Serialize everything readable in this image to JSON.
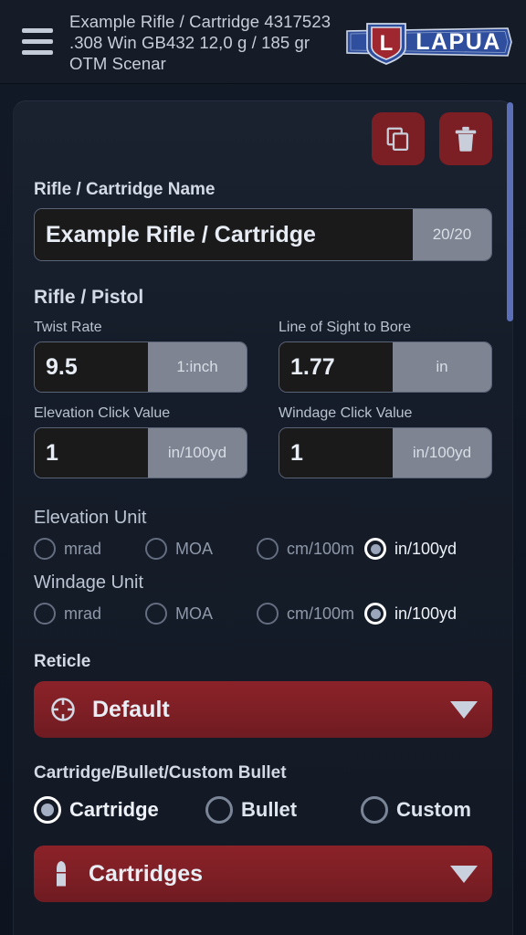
{
  "header": {
    "menu_icon": "hamburger-icon",
    "title": "Example Rifle / Cartridge 4317523 .308 Win GB432 12,0 g / 185 gr  OTM Scenar",
    "logo_text": "LAPUA",
    "logo_shield_letter": "L"
  },
  "toolbar": {
    "duplicate_icon": "copy-icon",
    "delete_icon": "trash-icon",
    "button_color": "#7c1f24"
  },
  "name_section": {
    "label": "Rifle / Cartridge Name",
    "value": "Example Rifle / Cartridge",
    "counter": "20/20"
  },
  "rifle_section": {
    "heading": "Rifle / Pistol",
    "fields": [
      {
        "label": "Twist Rate",
        "value": "9.5",
        "unit": "1:inch"
      },
      {
        "label": "Line of Sight to Bore",
        "value": "1.77",
        "unit": "in"
      },
      {
        "label": "Elevation Click Value",
        "value": "1",
        "unit": "in/100yd"
      },
      {
        "label": "Windage Click Value",
        "value": "1",
        "unit": "in/100yd"
      }
    ]
  },
  "elevation_unit": {
    "heading": "Elevation Unit",
    "options": [
      {
        "label": "mrad",
        "selected": false
      },
      {
        "label": "MOA",
        "selected": false
      },
      {
        "label": "cm/100m",
        "selected": false
      },
      {
        "label": "in/100yd",
        "selected": true
      }
    ]
  },
  "windage_unit": {
    "heading": "Windage Unit",
    "options": [
      {
        "label": "mrad",
        "selected": false
      },
      {
        "label": "MOA",
        "selected": false
      },
      {
        "label": "cm/100m",
        "selected": false
      },
      {
        "label": "in/100yd",
        "selected": true
      }
    ]
  },
  "reticle": {
    "label": "Reticle",
    "value": "Default",
    "icon": "crosshair-icon",
    "caret": "chevron-down-icon"
  },
  "source_section": {
    "heading": "Cartridge/Bullet/Custom Bullet",
    "options": [
      {
        "label": "Cartridge",
        "selected": true
      },
      {
        "label": "Bullet",
        "selected": false
      },
      {
        "label": "Custom",
        "selected": false
      }
    ]
  },
  "cartridge_dropdown": {
    "value": "Cartridges",
    "icon": "cartridge-icon",
    "caret": "chevron-down-icon"
  },
  "colors": {
    "accent_red": "#7c1f24",
    "scrollbar": "#5b6fb8",
    "page_bg": "#101725",
    "card_bg": "#161d2a"
  }
}
